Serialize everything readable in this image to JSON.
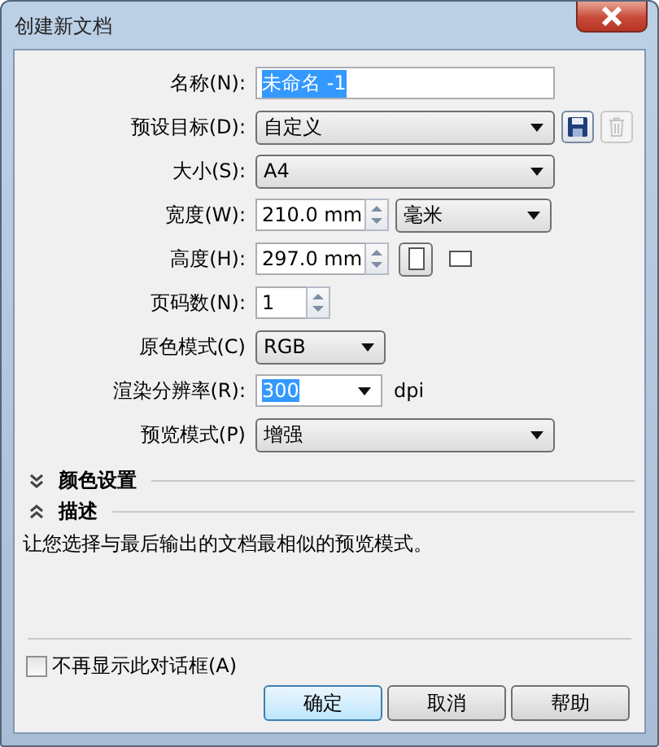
{
  "window": {
    "title": "创建新文档"
  },
  "rows": [
    {
      "label": "名称(N):",
      "kind": "text",
      "value": "未命名 -1",
      "highlighted": true
    },
    {
      "label": "预设目标(D):",
      "kind": "dropdown_actions",
      "value": "自定义",
      "delete_disabled": true
    },
    {
      "label": "大小(S):",
      "kind": "dropdown",
      "value": "A4"
    },
    {
      "label": "宽度(W):",
      "kind": "spinner_unit",
      "value": "210.0 mm",
      "unit": "毫米"
    },
    {
      "label": "高度(H):",
      "kind": "spinner_orientation",
      "value": "297.0 mm",
      "orientations": [
        {
          "kind": "portrait",
          "selected": true
        },
        {
          "kind": "landscape",
          "selected": false
        }
      ]
    },
    {
      "label": "页码数(N):",
      "kind": "spinner",
      "value": "1"
    },
    {
      "label": "原色模式(C)",
      "kind": "dropdown_short",
      "value": "RGB"
    },
    {
      "label": "渲染分辨率(R):",
      "kind": "combo_suffix",
      "value": "300",
      "highlighted": true,
      "suffix": "dpi"
    },
    {
      "label": "预览模式(P)",
      "kind": "dropdown",
      "value": "增强"
    }
  ],
  "sections": [
    {
      "title": "颜色设置",
      "expanded": false
    },
    {
      "title": "描述",
      "expanded": true,
      "text": "让您选择与最后输出的文档最相似的预览模式。"
    }
  ],
  "checkbox": {
    "label": "不再显示此对话框(A)",
    "checked": false
  },
  "buttons": [
    {
      "label": "确定",
      "default": true
    },
    {
      "label": "取消",
      "default": false
    },
    {
      "label": "帮助",
      "default": false
    }
  ]
}
